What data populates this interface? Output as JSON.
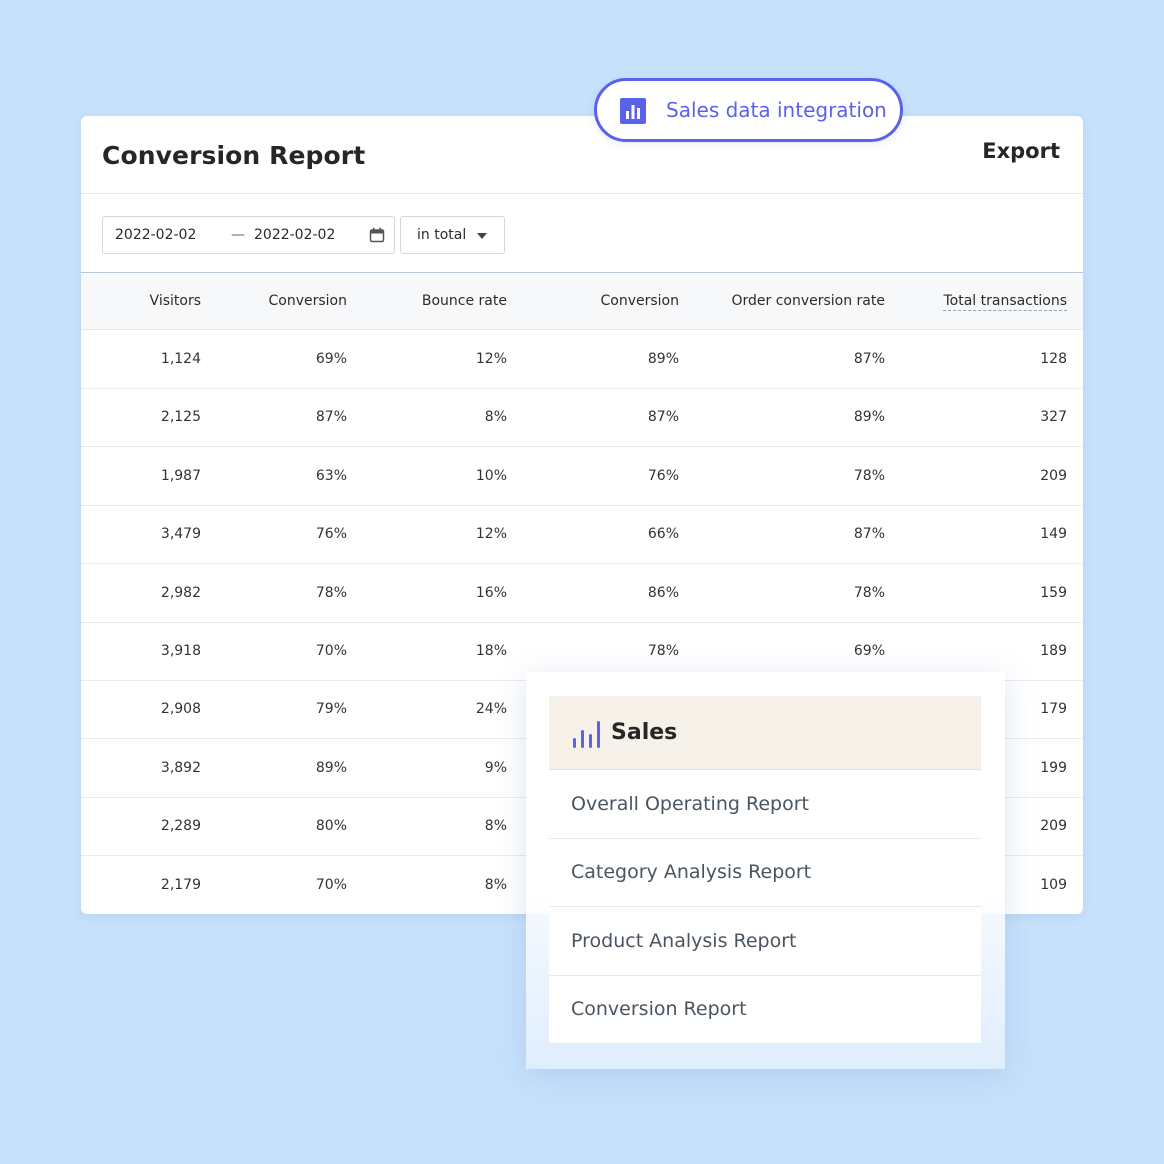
{
  "report": {
    "title": "Conversion Report",
    "export_label": "Export"
  },
  "filters": {
    "start_date": "2022-02-02",
    "separator": "—",
    "end_date": "2022-02-02",
    "aggregation": "in total"
  },
  "table": {
    "columns": [
      "Visitors",
      "Conversion",
      "Bounce rate",
      "Conversion",
      "Order conversion rate",
      "Total transactions"
    ],
    "rows": [
      [
        "1,124",
        "69%",
        "12%",
        "89%",
        "87%",
        "128"
      ],
      [
        "2,125",
        "87%",
        "8%",
        "87%",
        "89%",
        "327"
      ],
      [
        "1,987",
        "63%",
        "10%",
        "76%",
        "78%",
        "209"
      ],
      [
        "3,479",
        "76%",
        "12%",
        "66%",
        "87%",
        "149"
      ],
      [
        "2,982",
        "78%",
        "16%",
        "86%",
        "78%",
        "159"
      ],
      [
        "3,918",
        "70%",
        "18%",
        "78%",
        "69%",
        "189"
      ],
      [
        "2,908",
        "79%",
        "24%",
        "",
        "",
        "179"
      ],
      [
        "3,892",
        "89%",
        "9%",
        "",
        "",
        "199"
      ],
      [
        "2,289",
        "80%",
        "8%",
        "",
        "",
        "209"
      ],
      [
        "2,179",
        "70%",
        "8%",
        "",
        "",
        "109"
      ]
    ]
  },
  "badge": {
    "label": "Sales data integration",
    "icon": "bar-chart-icon",
    "color": "#5b62ea"
  },
  "menu": {
    "title": "Sales",
    "icon": "sales-bars-icon",
    "items": [
      "Overall Operating Report",
      "Category Analysis Report",
      "Product Analysis Report",
      "Conversion Report"
    ]
  },
  "colors": {
    "background": "#c6e1fc",
    "accent": "#5b62ea",
    "menu_header": "#f6f2ea"
  }
}
